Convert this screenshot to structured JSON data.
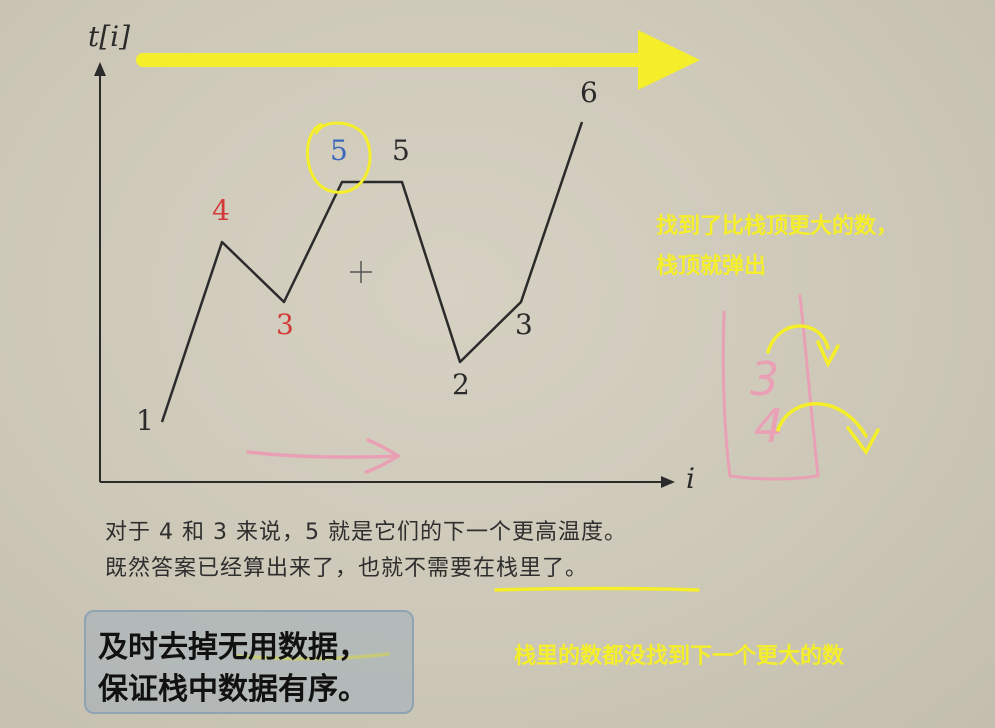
{
  "axis": {
    "y_label": "t[i]",
    "x_label": "i"
  },
  "chart_data": {
    "type": "line",
    "x": [
      1,
      2,
      3,
      4,
      5,
      6,
      7,
      8
    ],
    "values": [
      1,
      4,
      3,
      5,
      5,
      2,
      3,
      6
    ],
    "labels": [
      "1",
      "4",
      "3",
      "5",
      "5",
      "2",
      "3",
      "6"
    ],
    "highlighted_points": [
      {
        "index": 1,
        "color": "#d23a3a"
      },
      {
        "index": 2,
        "color": "#d23a3a"
      },
      {
        "index": 3,
        "color": "#3b68b8"
      }
    ],
    "default_label_color": "#2b2b2b"
  },
  "caption": {
    "line1": "对于 4 和 3 来说，5 就是它们的下一个更高温度。",
    "line2": "既然答案已经算出来了，也就不需要在栈里了。"
  },
  "annotations": {
    "note_pop_line1": "找到了比栈顶更大的数，",
    "note_pop_line2": "栈顶就弹出",
    "note_stack": "栈里的数都没找到下一个更大的数",
    "stack_values": [
      "3",
      "4"
    ]
  },
  "callout": {
    "line1": "及时去掉无用数据，",
    "line2": "保证栈中数据有序。"
  },
  "colors": {
    "yellow": "#f5ee2a",
    "pink": "#e9a0b5",
    "red": "#d23a3a",
    "blue": "#3b68b8",
    "line": "#2b2b2b"
  }
}
